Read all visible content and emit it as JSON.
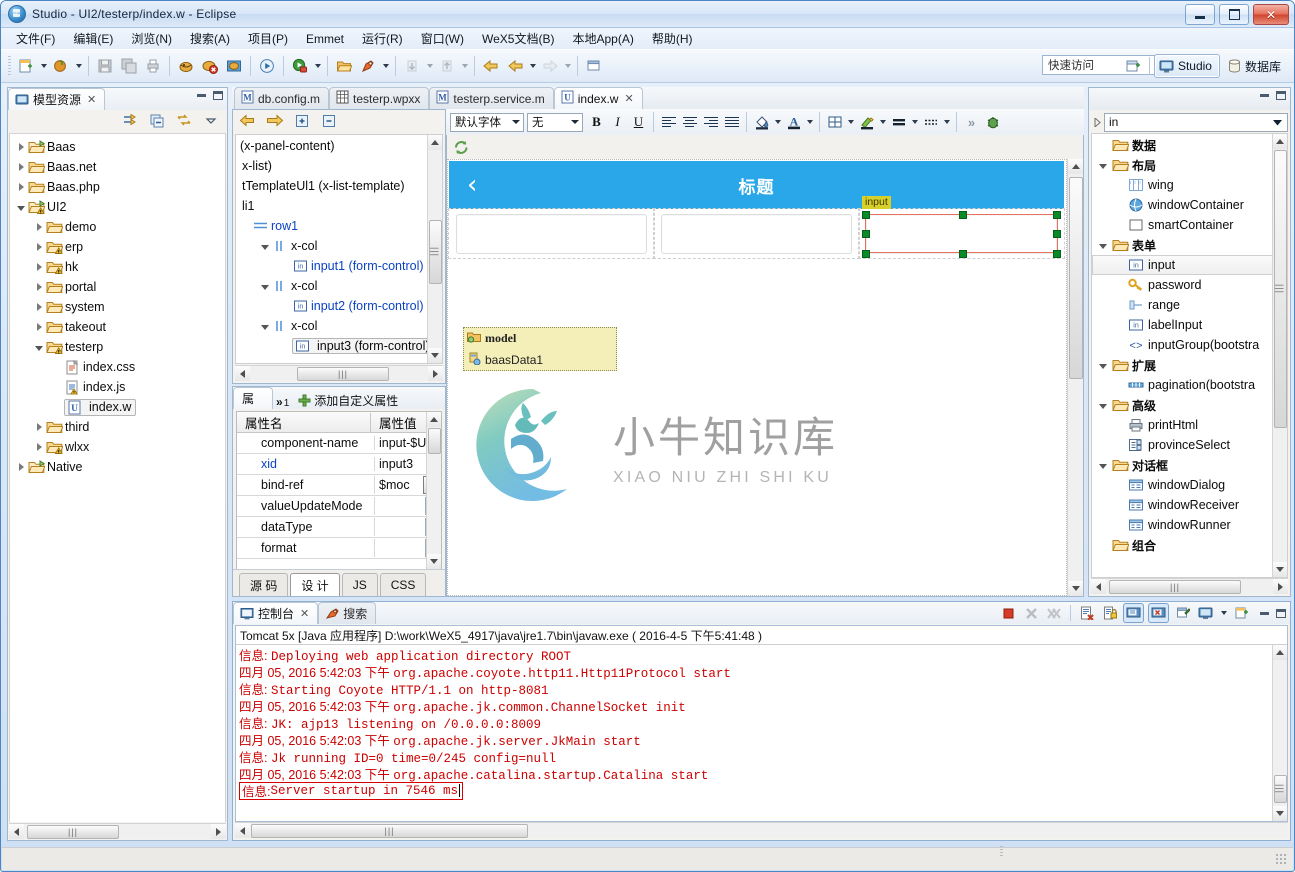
{
  "window": {
    "title": "Studio - UI2/testerp/index.w - Eclipse",
    "app_icon": "eclipse-icon",
    "minimize": "minimize",
    "maximize": "maximize",
    "close": "close"
  },
  "menubar": {
    "items": [
      {
        "label": "文件(F)",
        "mnemonic": "F"
      },
      {
        "label": "编辑(E)",
        "mnemonic": "E"
      },
      {
        "label": "浏览(N)",
        "mnemonic": "N"
      },
      {
        "label": "搜索(A)",
        "mnemonic": "A"
      },
      {
        "label": "项目(P)",
        "mnemonic": "P"
      },
      {
        "label": "Emmet",
        "mnemonic": "E"
      },
      {
        "label": "运行(R)",
        "mnemonic": "R"
      },
      {
        "label": "窗口(W)",
        "mnemonic": "W"
      },
      {
        "label": "WeX5文档(B)",
        "mnemonic": "B"
      },
      {
        "label": "本地App(A)",
        "mnemonic": "A"
      },
      {
        "label": "帮助(H)",
        "mnemonic": "H"
      }
    ]
  },
  "toolbar": {
    "quick_access_placeholder": "快速访问",
    "perspectives": [
      {
        "label": "Studio",
        "icon": "monitor-icon",
        "active": true
      },
      {
        "label": "数据库",
        "icon": "database-icon",
        "active": false
      }
    ],
    "open_perspective_icon": "open-perspective-icon"
  },
  "model_explorer": {
    "tab_label": "模型资源",
    "tab_icon": "model-explorer-icon",
    "toolbar_icons": [
      "link-with-editor-icon",
      "collapse-all-icon",
      "sync-icon",
      "view-menu-icon"
    ],
    "tree": [
      {
        "label": "Baas",
        "depth": 0,
        "icon": "project-folder-icon",
        "state": "collapsed"
      },
      {
        "label": "Baas.net",
        "depth": 0,
        "icon": "folder-icon",
        "state": "collapsed"
      },
      {
        "label": "Baas.php",
        "depth": 0,
        "icon": "folder-icon",
        "state": "collapsed"
      },
      {
        "label": "UI2",
        "depth": 0,
        "icon": "project-folder-warning-icon",
        "state": "expanded"
      },
      {
        "label": "demo",
        "depth": 1,
        "icon": "folder-icon",
        "state": "collapsed"
      },
      {
        "label": "erp",
        "depth": 1,
        "icon": "folder-warning-icon",
        "state": "collapsed"
      },
      {
        "label": "hk",
        "depth": 1,
        "icon": "folder-warning-icon",
        "state": "collapsed"
      },
      {
        "label": "portal",
        "depth": 1,
        "icon": "folder-icon",
        "state": "collapsed"
      },
      {
        "label": "system",
        "depth": 1,
        "icon": "folder-icon",
        "state": "collapsed"
      },
      {
        "label": "takeout",
        "depth": 1,
        "icon": "folder-icon",
        "state": "collapsed"
      },
      {
        "label": "testerp",
        "depth": 1,
        "icon": "folder-warning-icon",
        "state": "expanded"
      },
      {
        "label": "index.css",
        "depth": 2,
        "icon": "css-file-icon",
        "state": "leaf"
      },
      {
        "label": "index.js",
        "depth": 2,
        "icon": "js-file-warning-icon",
        "state": "leaf"
      },
      {
        "label": "index.w",
        "depth": 2,
        "icon": "w-file-icon",
        "state": "leaf",
        "selected": true
      },
      {
        "label": "third",
        "depth": 1,
        "icon": "folder-icon",
        "state": "collapsed"
      },
      {
        "label": "wlxx",
        "depth": 1,
        "icon": "folder-warning-icon",
        "state": "collapsed"
      },
      {
        "label": "Native",
        "depth": 0,
        "icon": "project-folder-icon",
        "state": "collapsed"
      }
    ]
  },
  "editor": {
    "tabs": [
      {
        "label": "db.config.m",
        "icon": "m-file-icon",
        "active": false
      },
      {
        "label": "testerp.wpxx",
        "icon": "grid-file-icon",
        "active": false
      },
      {
        "label": "testerp.service.m",
        "icon": "m-file-icon",
        "active": false
      },
      {
        "label": "index.w",
        "icon": "w-file-icon",
        "active": true,
        "closable": true
      }
    ],
    "format_toolbar": {
      "font_family": "默认字体",
      "font_size": "无",
      "bold": "B",
      "italic": "I",
      "underline": "U",
      "align_left": "align-left-icon",
      "align_center": "align-center-icon",
      "align_right": "align-right-icon",
      "align_justify": "align-justify-icon",
      "fill_color": "fill-color-icon",
      "font_color": "font-color-icon",
      "table": "table-icon",
      "highlight": "highlight-pen-icon",
      "border": "border-icon",
      "dashed_border": "dashed-border-icon",
      "overflow": "»",
      "debug": "debug-icon"
    },
    "refresh_icon": "refresh-icon",
    "phone": {
      "back_icon": "‹",
      "title": "标题"
    },
    "selected_widget": {
      "tag_label": "input",
      "handles": 8
    },
    "model_box": {
      "title": "model",
      "title_icon": "model-folder-icon",
      "items": [
        {
          "label": "baasData1",
          "icon": "baas-data-icon"
        }
      ]
    },
    "watermark": {
      "cn": "小牛知识库",
      "en": "XIAO NIU ZHI SHI KU"
    },
    "bottom_tabs": [
      {
        "label": "源 码",
        "active": false
      },
      {
        "label": "设 计",
        "active": true
      },
      {
        "label": "JS",
        "active": false
      },
      {
        "label": "CSS",
        "active": false
      }
    ]
  },
  "outline": {
    "toolbar_icons": [
      "back-arrow-icon",
      "forward-arrow-icon",
      "expand-all-icon",
      "collapse-all-icon"
    ],
    "rows": [
      {
        "label": "(x-panel-content)",
        "indent": 0,
        "type": "plain"
      },
      {
        "label": "x-list)",
        "indent": -1,
        "type": "plain"
      },
      {
        "label": "tTemplateUl1 (x-list-template)",
        "indent": -1,
        "type": "plain"
      },
      {
        "label": "li1",
        "indent": -1,
        "type": "plain"
      },
      {
        "label": "row1",
        "indent": 0,
        "type": "row",
        "link": true
      },
      {
        "label": "x-col",
        "indent": 1,
        "type": "col",
        "state": "expanded"
      },
      {
        "label": "input1 (form-control)",
        "indent": 2,
        "type": "input",
        "link": true
      },
      {
        "label": "x-col",
        "indent": 1,
        "type": "col",
        "state": "expanded"
      },
      {
        "label": "input2 (form-control)",
        "indent": 2,
        "type": "input",
        "link": true
      },
      {
        "label": "x-col",
        "indent": 1,
        "type": "col",
        "state": "expanded"
      },
      {
        "label": "input3 (form-control)",
        "indent": 2,
        "type": "input",
        "selected": true
      }
    ]
  },
  "properties": {
    "tab_label": "属",
    "tab_overflow": "»",
    "tab_overflow_count": "1",
    "add_custom_label": "添加自定义属性",
    "add_icon": "plus-icon",
    "columns": [
      "属性名",
      "属性值"
    ],
    "rows": [
      {
        "name": "component-name",
        "value": "input-$U",
        "control": "none"
      },
      {
        "name": "xid",
        "value": "input3",
        "control": "none",
        "highlight": true
      },
      {
        "name": "bind-ref",
        "value": "$moc",
        "control": "ellipsis"
      },
      {
        "name": "valueUpdateMode",
        "value": "",
        "control": "dropdown"
      },
      {
        "name": "dataType",
        "value": "",
        "control": "dropdown"
      },
      {
        "name": "format",
        "value": "",
        "control": "dropdown"
      }
    ]
  },
  "components_palette": {
    "filter_value": "in",
    "tree": [
      {
        "label": "数据",
        "depth": 0,
        "type": "folder",
        "state": "none",
        "bold": true
      },
      {
        "label": "布局",
        "depth": 0,
        "type": "folder",
        "state": "expanded",
        "bold": true
      },
      {
        "label": "wing",
        "depth": 1,
        "type": "wing-icon"
      },
      {
        "label": "windowContainer",
        "depth": 1,
        "type": "window-container-icon"
      },
      {
        "label": "smartContainer",
        "depth": 1,
        "type": "smart-container-icon"
      },
      {
        "label": "表单",
        "depth": 0,
        "type": "folder",
        "state": "expanded",
        "bold": true
      },
      {
        "label": "input",
        "depth": 1,
        "type": "input-icon",
        "selected": true
      },
      {
        "label": "password",
        "depth": 1,
        "type": "key-icon"
      },
      {
        "label": "range",
        "depth": 1,
        "type": "range-icon"
      },
      {
        "label": "labelInput",
        "depth": 1,
        "type": "input-icon"
      },
      {
        "label": "inputGroup(bootstra",
        "depth": 1,
        "type": "code-icon"
      },
      {
        "label": "扩展",
        "depth": 0,
        "type": "folder",
        "state": "expanded",
        "bold": true
      },
      {
        "label": "pagination(bootstra",
        "depth": 1,
        "type": "pagination-icon"
      },
      {
        "label": "高级",
        "depth": 0,
        "type": "folder",
        "state": "expanded",
        "bold": true
      },
      {
        "label": "printHtml",
        "depth": 1,
        "type": "printer-icon"
      },
      {
        "label": "provinceSelect",
        "depth": 1,
        "type": "select-icon"
      },
      {
        "label": "对话框",
        "depth": 0,
        "type": "folder",
        "state": "expanded",
        "bold": true
      },
      {
        "label": "windowDialog",
        "depth": 1,
        "type": "dialog-icon"
      },
      {
        "label": "windowReceiver",
        "depth": 1,
        "type": "dialog-icon"
      },
      {
        "label": "windowRunner",
        "depth": 1,
        "type": "dialog-icon"
      },
      {
        "label": "组合",
        "depth": 0,
        "type": "folder",
        "state": "none",
        "bold": true
      }
    ]
  },
  "console": {
    "tabs": [
      {
        "label": "控制台",
        "icon": "console-icon",
        "active": true,
        "closable": true
      },
      {
        "label": "搜索",
        "icon": "search-icon",
        "active": false
      }
    ],
    "toolbar_icons": [
      "terminate-icon",
      "remove-launch-icon",
      "remove-all-launches-icon",
      "clear-console-icon",
      "scroll-lock-icon",
      "show-console-on-output-icon",
      "show-console-on-error-icon",
      "pin-console-icon",
      "display-console-icon",
      "open-console-icon"
    ],
    "process_header": "Tomcat 5x [Java 应用程序] D:\\work\\WeX5_4917\\java\\jre1.7\\bin\\javaw.exe ( 2016-4-5 下午5:41:48 )",
    "lines": [
      {
        "prefix": "信息: ",
        "text": "Deploying web application directory ROOT"
      },
      {
        "prefix": "四月 05, 2016 5:42:03 下午 ",
        "text": "org.apache.coyote.http11.Http11Protocol start"
      },
      {
        "prefix": "信息: ",
        "text": "Starting Coyote HTTP/1.1 on http-8081"
      },
      {
        "prefix": "四月 05, 2016 5:42:03 下午 ",
        "text": "org.apache.jk.common.ChannelSocket init"
      },
      {
        "prefix": "信息: ",
        "text": "JK: ajp13 listening on /0.0.0.0:8009"
      },
      {
        "prefix": "四月 05, 2016 5:42:03 下午 ",
        "text": "org.apache.jk.server.JkMain start"
      },
      {
        "prefix": "信息: ",
        "text": "Jk running ID=0 time=0/245  config=null"
      },
      {
        "prefix": "四月 05, 2016 5:42:03 下午 ",
        "text": "org.apache.catalina.startup.Catalina start"
      },
      {
        "prefix": "信息: ",
        "text": "Server startup in 7546 ms",
        "highlighted": true
      }
    ]
  },
  "colors": {
    "accent_blue": "#2aa7e8",
    "console_red": "#cc0000",
    "selection_green": "#0a8b27",
    "selection_rect": "#e8705c",
    "tag_yellow": "#d7d02a",
    "model_box": "#f4eeb9"
  }
}
